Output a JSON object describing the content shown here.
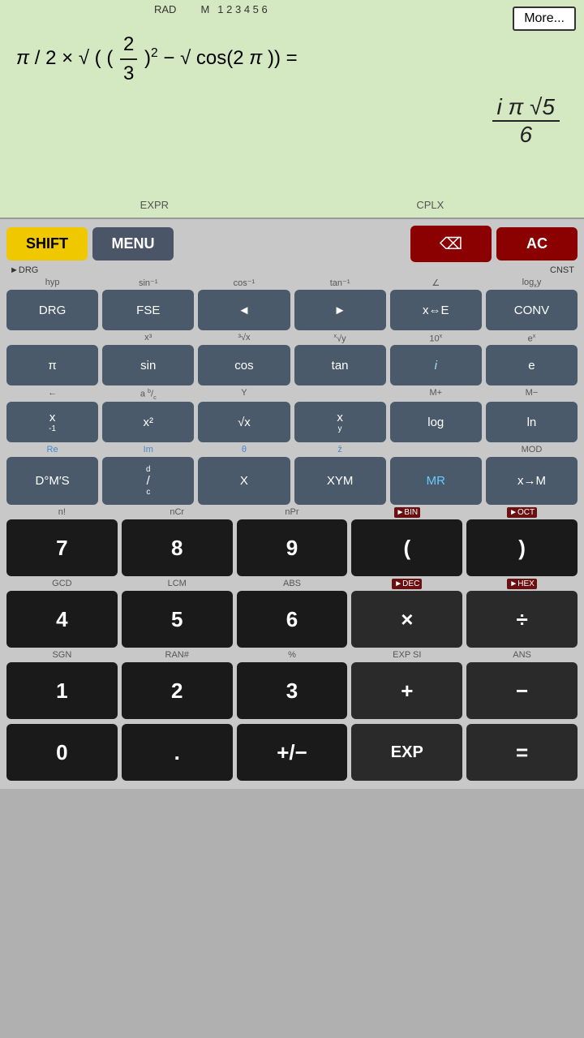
{
  "display": {
    "mode": "RAD",
    "memory_indicator": "M",
    "memory_slots": "1 2 3 4 5 6",
    "more_button": "More...",
    "expression": "π/2 × √((2/3)² − √cos(2π)) =",
    "result_numerator": "i π √5",
    "result_denominator": "6",
    "expr_label": "EXPR",
    "cplx_label": "CPLX"
  },
  "controls": {
    "shift": "SHIFT",
    "menu": "MENU",
    "ac": "AC",
    "drg_label": "►DRG",
    "cnst_label": "CNST"
  },
  "row1": {
    "labels": [
      "hyp",
      "sin⁻¹",
      "cos⁻¹",
      "tan⁻¹",
      "∠",
      "logₓy"
    ],
    "buttons": [
      "DRG",
      "FSE",
      "◄",
      "►",
      "x⇔E",
      "CONV"
    ]
  },
  "row2": {
    "labels": [
      "x³",
      "³√x",
      "ˣ√y",
      "10ˣ",
      "eˣ"
    ],
    "buttons": [
      "π",
      "sin",
      "cos",
      "tan",
      "i",
      "e"
    ]
  },
  "row3": {
    "labels": [
      "←",
      "aᵇ/c",
      "Y",
      "M+",
      "M−"
    ],
    "buttons": [
      "x⁻¹",
      "x²",
      "√x",
      "xʸ",
      "log",
      "ln"
    ]
  },
  "row4": {
    "labels": [
      "Re",
      "Im",
      "θ",
      "z̄",
      "MOD"
    ],
    "buttons": [
      "D°M′S",
      "d/c",
      "X",
      "XYM",
      "MR",
      "x→M"
    ]
  },
  "row5": {
    "labels": [
      "n!",
      "nCr",
      "nPr",
      "►BIN",
      "►OCT"
    ],
    "buttons": [
      "7",
      "8",
      "9",
      "(",
      ")"
    ]
  },
  "row6": {
    "labels": [
      "GCD",
      "LCM",
      "ABS",
      "►DEC",
      "►HEX"
    ],
    "buttons": [
      "4",
      "5",
      "6",
      "×",
      "÷"
    ]
  },
  "row7": {
    "labels": [
      "SGN",
      "RAN#",
      "%",
      "EXP SI",
      "ANS"
    ],
    "buttons": [
      "1",
      "2",
      "3",
      "+",
      "−"
    ]
  },
  "row8": {
    "buttons": [
      "0",
      ".",
      "+/−",
      "EXP",
      "="
    ]
  }
}
